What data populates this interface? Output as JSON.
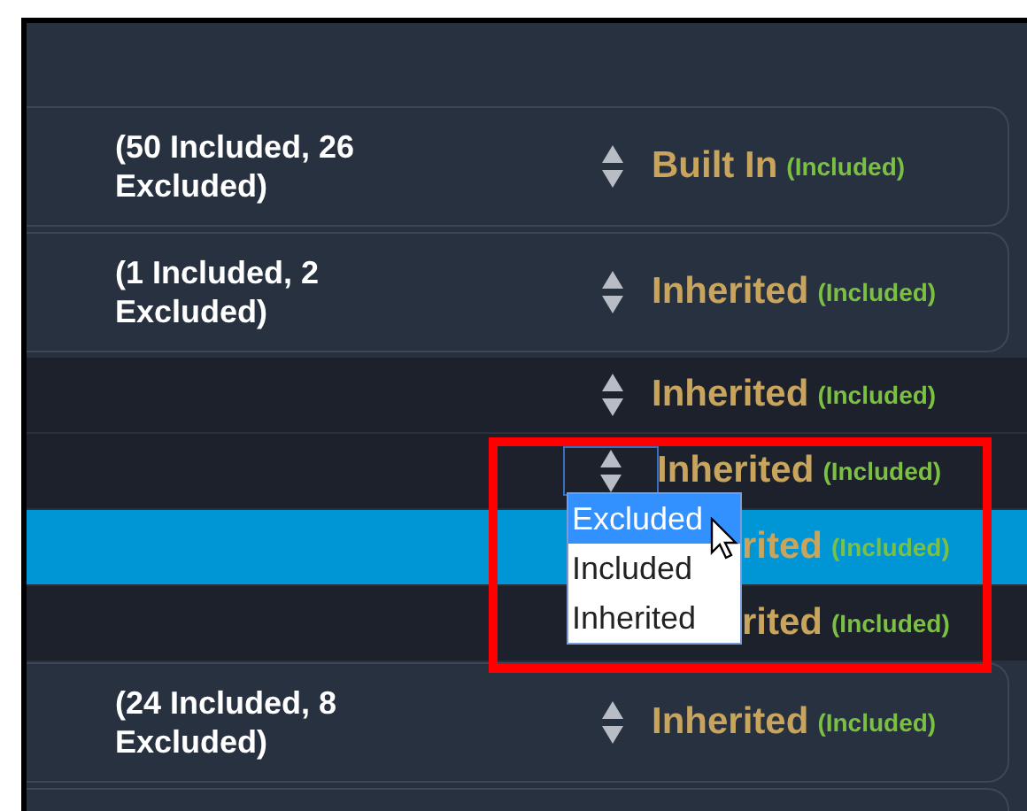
{
  "rows": [
    {
      "kind": "group",
      "selected": false,
      "summary": "(50 Included, 26 Excluded)",
      "setting": "Built In",
      "effective": "(Included)"
    },
    {
      "kind": "group",
      "selected": false,
      "summary": "(1 Included, 2 Excluded)",
      "setting": "Inherited",
      "effective": "(Included)"
    },
    {
      "kind": "item",
      "selected": false,
      "setting": "Inherited",
      "effective": "(Included)"
    },
    {
      "kind": "item",
      "selected": false,
      "setting": "Inherited",
      "effective": "(Included)",
      "dropdown": {
        "options": [
          {
            "label": "Excluded",
            "selected": true
          },
          {
            "label": "Included",
            "selected": false
          },
          {
            "label": "Inherited",
            "selected": false
          }
        ]
      }
    },
    {
      "kind": "covered",
      "selected": true,
      "setting": "rited",
      "effective": "(Included)"
    },
    {
      "kind": "covered",
      "selected": false,
      "setting": "rited",
      "effective": "(Included)"
    },
    {
      "kind": "group",
      "selected": false,
      "summary": "(24 Included, 8 Excluded)",
      "setting": "Inherited",
      "effective": "(Included)"
    },
    {
      "kind": "group",
      "selected": false
    }
  ]
}
